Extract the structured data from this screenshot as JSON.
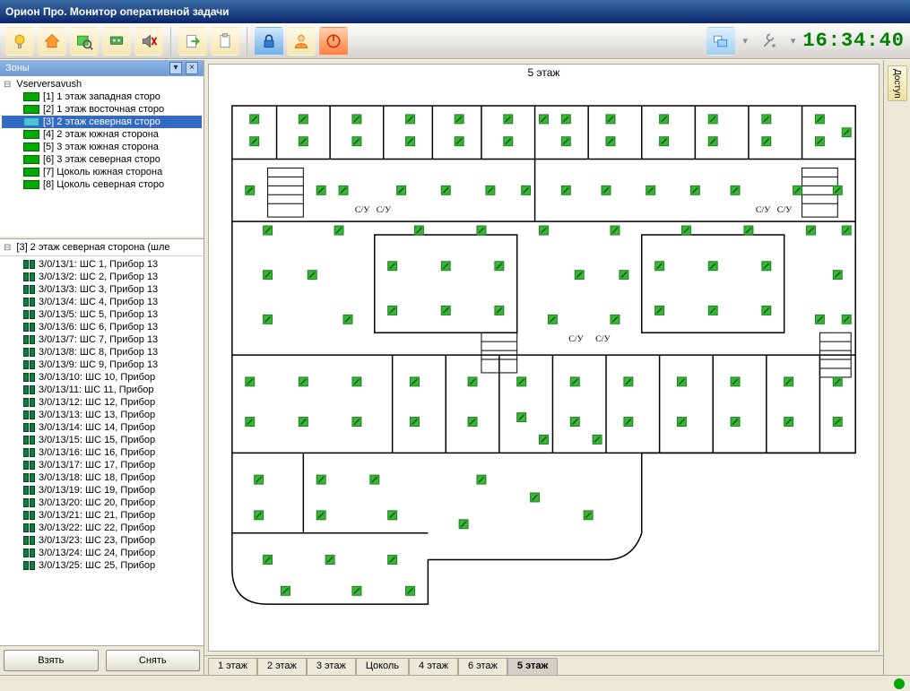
{
  "window": {
    "title": "Орион Про. Монитор оперативной задачи"
  },
  "clock": "16:34:40",
  "zones_panel": {
    "title": "Зоны"
  },
  "tree": {
    "root": "Vserversavush",
    "items": [
      {
        "label": "[1] 1 этаж западная сторо"
      },
      {
        "label": "[2] 1 этаж восточная сторо"
      },
      {
        "label": "[3] 2 этаж северная сторо",
        "selected": true
      },
      {
        "label": "[4] 2 этаж южная сторона"
      },
      {
        "label": "[5] 3 этаж южная сторона"
      },
      {
        "label": "[6] 3 этаж северная сторо"
      },
      {
        "label": "[7] Цоколь южная сторона"
      },
      {
        "label": "[8] Цоколь северная сторо"
      }
    ]
  },
  "detail_header": "[3] 2 этаж северная сторона (шле",
  "devices": [
    {
      "label": "3/0/13/1: ШС 1, Прибор 13"
    },
    {
      "label": "3/0/13/2: ШС 2, Прибор 13"
    },
    {
      "label": "3/0/13/3: ШС 3, Прибор 13"
    },
    {
      "label": "3/0/13/4: ШС 4, Прибор 13"
    },
    {
      "label": "3/0/13/5: ШС 5, Прибор 13"
    },
    {
      "label": "3/0/13/6: ШС 6, Прибор 13"
    },
    {
      "label": "3/0/13/7: ШС 7, Прибор 13"
    },
    {
      "label": "3/0/13/8: ШС 8, Прибор 13"
    },
    {
      "label": "3/0/13/9: ШС 9, Прибор 13"
    },
    {
      "label": "3/0/13/10: ШС 10, Прибор"
    },
    {
      "label": "3/0/13/11: ШС 11, Прибор"
    },
    {
      "label": "3/0/13/12: ШС 12, Прибор"
    },
    {
      "label": "3/0/13/13: ШС 13, Прибор"
    },
    {
      "label": "3/0/13/14: ШС 14, Прибор"
    },
    {
      "label": "3/0/13/15: ШС 15, Прибор"
    },
    {
      "label": "3/0/13/16: ШС 16, Прибор"
    },
    {
      "label": "3/0/13/17: ШС 17, Прибор"
    },
    {
      "label": "3/0/13/18: ШС 18, Прибор"
    },
    {
      "label": "3/0/13/19: ШС 19, Прибор"
    },
    {
      "label": "3/0/13/20: ШС 20, Прибор"
    },
    {
      "label": "3/0/13/21: ШС 21, Прибор"
    },
    {
      "label": "3/0/13/22: ШС 22, Прибор"
    },
    {
      "label": "3/0/13/23: ШС 23, Прибор"
    },
    {
      "label": "3/0/13/24: ШС 24, Прибор"
    },
    {
      "label": "3/0/13/25: ШС 25, Прибор"
    }
  ],
  "buttons": {
    "take": "Взять",
    "remove": "Снять"
  },
  "plan": {
    "title": "5 этаж",
    "rooms_label_su": "С/У"
  },
  "tabs": [
    {
      "label": "1 этаж"
    },
    {
      "label": "2 этаж"
    },
    {
      "label": "3 этаж"
    },
    {
      "label": "Цоколь"
    },
    {
      "label": "4 этаж"
    },
    {
      "label": "6 этаж"
    },
    {
      "label": "5 этаж",
      "active": true
    }
  ],
  "rightbar": {
    "access": "Доступ"
  },
  "toolbar_icons": [
    "bulb-icon",
    "home-icon",
    "zoom-plan-icon",
    "device-icon",
    "sound-off-icon",
    "export-icon",
    "clipboard-icon",
    "lock-icon",
    "user-icon",
    "power-icon",
    "windows-icon",
    "tools-icon"
  ]
}
